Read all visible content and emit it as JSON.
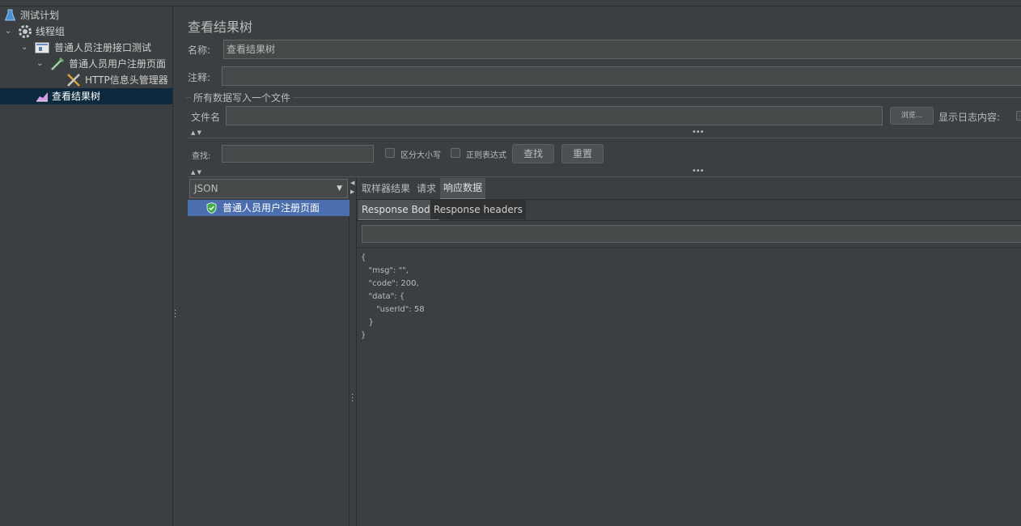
{
  "tree": {
    "items": [
      {
        "label": "测试计划"
      },
      {
        "label": "线程组"
      },
      {
        "label": "普通人员注册接口测试"
      },
      {
        "label": "普通人员用户注册页面"
      },
      {
        "label": "HTTP信息头管理器"
      },
      {
        "label": "查看结果树"
      }
    ]
  },
  "panel": {
    "title": "查看结果树",
    "name_label": "名称:",
    "name_value": "查看结果树",
    "comment_label": "注释:",
    "file_group_label": "所有数据写入一个文件",
    "filename_label": "文件名",
    "browse_label": "浏览...",
    "show_log_label": "显示日志内容:"
  },
  "search": {
    "label": "查找:",
    "case_label": "区分大小写",
    "regex_label": "正则表达式",
    "find_button": "查找",
    "reset_button": "重置"
  },
  "renderer": {
    "selected": "JSON"
  },
  "results": {
    "items": [
      {
        "label": "普通人员用户注册页面",
        "status": "success"
      }
    ]
  },
  "tabs": {
    "main": [
      {
        "label": "取样器结果"
      },
      {
        "label": "请求"
      },
      {
        "label": "响应数据",
        "active": true
      }
    ],
    "sub": [
      {
        "label": "Response Body",
        "active": true
      },
      {
        "label": "Response headers"
      }
    ]
  },
  "response_body": "{\n   \"msg\": \"\",\n   \"code\": 200,\n   \"data\": {\n      \"userId\": 58\n   }\n}"
}
